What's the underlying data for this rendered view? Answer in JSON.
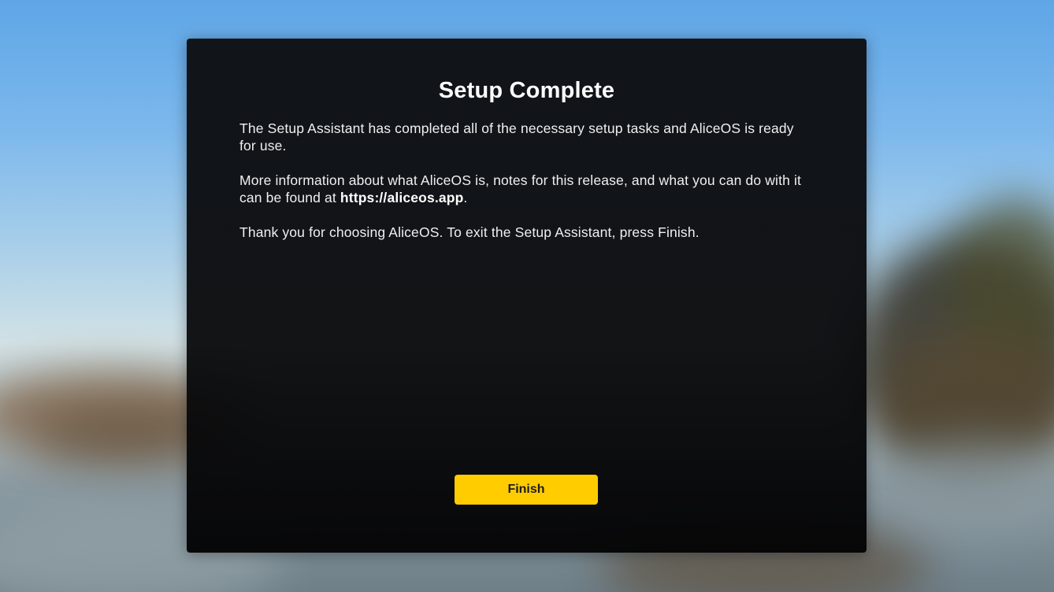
{
  "dialog": {
    "title": "Setup Complete",
    "paragraph1": "The Setup Assistant has completed all of the necessary setup tasks and AliceOS is ready for use.",
    "paragraph2_before": "More information about what AliceOS is, notes for this release, and what you can do with it can be found at ",
    "paragraph2_link": "https://aliceos.app",
    "paragraph2_after": ".",
    "paragraph3": "Thank you for choosing AliceOS. To exit the Setup Assistant, press Finish.",
    "finish_label": "Finish"
  },
  "colors": {
    "accent": "#ffcc00",
    "dialog_background": "#0e1013",
    "text": "#f0f0f0"
  }
}
